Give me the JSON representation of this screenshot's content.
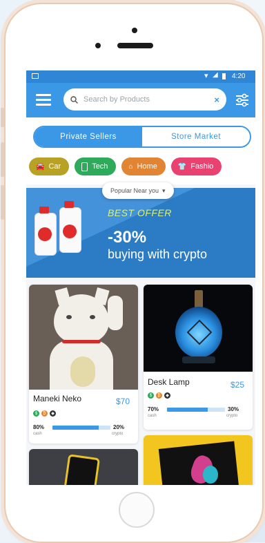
{
  "status": {
    "time": "4:20"
  },
  "search": {
    "placeholder": "Search by Products",
    "clear": "×"
  },
  "segments": {
    "private": "Private Sellers",
    "store": "Store Market"
  },
  "categories": [
    {
      "label": "Car",
      "color": "#b8a226",
      "icon": "car-icon"
    },
    {
      "label": "Tech",
      "color": "#2eaa5b",
      "icon": "phone-icon"
    },
    {
      "label": "Home",
      "color": "#e18434",
      "icon": "home-icon"
    },
    {
      "label": "Fashio",
      "color": "#e94270",
      "icon": "shirt-icon"
    }
  ],
  "popular": {
    "label": "Popular Near you",
    "caret": "▾"
  },
  "banner": {
    "best": "BEST OFFER",
    "percent": "-30%",
    "subtitle": "buying with crypto"
  },
  "products": [
    {
      "name": "Maneki Neko",
      "price": "$70",
      "cash_pct": "80%",
      "cash_label": "cash",
      "crypto_pct": "20%",
      "crypto_label": "crypto",
      "cash_fraction": 0.8
    },
    {
      "name": "Desk Lamp",
      "price": "$25",
      "cash_pct": "70%",
      "cash_label": "cash",
      "crypto_pct": "30%",
      "crypto_label": "crypto",
      "cash_fraction": 0.7
    }
  ],
  "colors": {
    "primary": "#3a98e6",
    "banner": "#2f86d6",
    "coin_green": "#2eaa5b",
    "coin_orange": "#e18434",
    "coin_dark": "#333333"
  }
}
